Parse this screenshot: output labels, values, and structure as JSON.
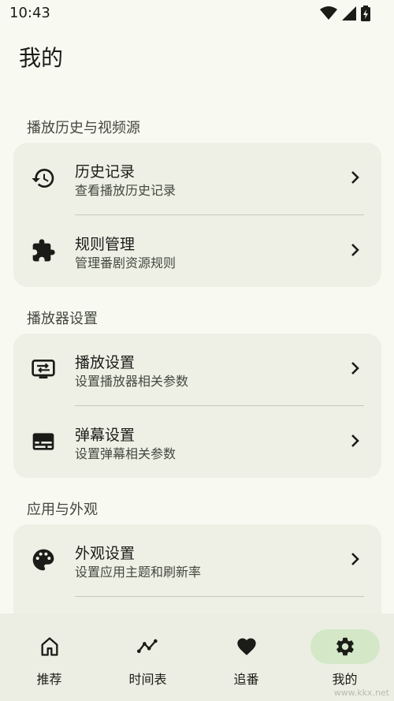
{
  "status_bar": {
    "time": "10:43",
    "icons": [
      "wifi-icon",
      "signal-icon",
      "battery-icon"
    ]
  },
  "page_title": "我的",
  "sections": [
    {
      "header": "播放历史与视频源",
      "items": [
        {
          "title": "历史记录",
          "subtitle": "查看播放历史记录",
          "icon": "history-icon"
        },
        {
          "title": "规则管理",
          "subtitle": "管理番剧资源规则",
          "icon": "puzzle-icon"
        }
      ]
    },
    {
      "header": "播放器设置",
      "items": [
        {
          "title": "播放设置",
          "subtitle": "设置播放器相关参数",
          "icon": "player-settings-icon"
        },
        {
          "title": "弹幕设置",
          "subtitle": "设置弹幕相关参数",
          "icon": "subtitles-icon"
        }
      ]
    },
    {
      "header": "应用与外观",
      "items": [
        {
          "title": "外观设置",
          "subtitle": "设置应用主题和刷新率",
          "icon": "palette-icon"
        }
      ]
    }
  ],
  "bottom_nav": {
    "selected": 3,
    "items": [
      {
        "label": "推荐",
        "icon": "home-icon"
      },
      {
        "label": "时间表",
        "icon": "timeline-icon"
      },
      {
        "label": "追番",
        "icon": "heart-icon"
      },
      {
        "label": "我的",
        "icon": "gear-icon"
      }
    ]
  },
  "watermark": "www.kkx.net",
  "colors": {
    "background": "#f8f9f1",
    "card": "#eef0e5",
    "nav_selected_pill": "#d4e8c8",
    "text": "#1b1c18"
  }
}
